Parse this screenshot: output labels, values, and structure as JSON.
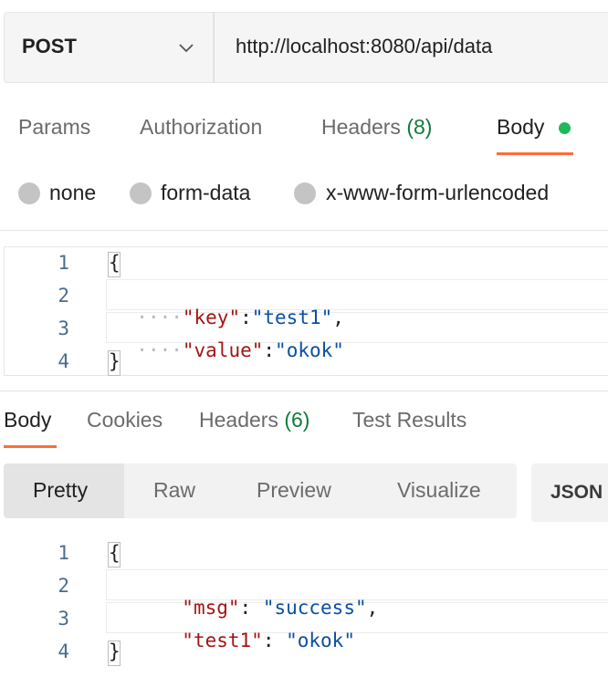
{
  "request": {
    "method": "POST",
    "url": "http://localhost:8080/api/data"
  },
  "request_tabs": {
    "params": "Params",
    "authorization": "Authorization",
    "headers": "Headers",
    "headers_count": "(8)",
    "body": "Body"
  },
  "body_types": {
    "none": "none",
    "form_data": "form-data",
    "urlencoded": "x-www-form-urlencoded"
  },
  "request_body": {
    "line_numbers": [
      "1",
      "2",
      "3",
      "4"
    ],
    "open_brace": "{",
    "close_brace": "}",
    "indent_dots": "····",
    "line2_key": "\"key\"",
    "line2_colon": ":",
    "line2_value": "\"test1\"",
    "line2_comma": ",",
    "line3_key": "\"value\"",
    "line3_colon": ":",
    "line3_value": "\"okok\""
  },
  "response_tabs": {
    "body": "Body",
    "cookies": "Cookies",
    "headers": "Headers",
    "headers_count": "(6)",
    "test_results": "Test Results"
  },
  "view_modes": {
    "pretty": "Pretty",
    "raw": "Raw",
    "preview": "Preview",
    "visualize": "Visualize",
    "format": "JSON"
  },
  "response_body": {
    "line_numbers": [
      "1",
      "2",
      "3",
      "4"
    ],
    "open_brace": "{",
    "close_brace": "}",
    "line2_key": "\"msg\"",
    "line2_colon": ": ",
    "line2_value": "\"success\"",
    "line2_comma": ",",
    "line3_key": "\"test1\"",
    "line3_colon": ": ",
    "line3_value": "\"okok\""
  },
  "colors": {
    "accent": "#ff6c37",
    "status_green": "#1fb85a",
    "json_key": "#a31515",
    "json_string": "#0b4fa3"
  }
}
